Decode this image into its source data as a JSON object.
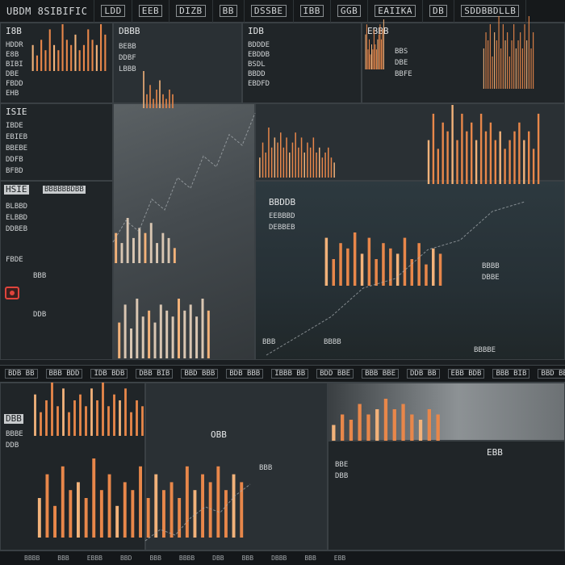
{
  "topbar": {
    "segments": [
      "UBDM 8SIBIFIC",
      "LDD",
      "EEB",
      "DIZB",
      "BB",
      "DSSBE",
      "IBB",
      "GGB",
      "EAIIKA",
      "DB",
      "SDDBBDLLB"
    ]
  },
  "panels": {
    "top_left": {
      "title": "I8B",
      "rows": [
        "HDDR",
        "E8B",
        "BIBI",
        "DBE",
        "FBDD",
        "EHB"
      ]
    },
    "top_mid": {
      "title": "DBBB",
      "rows": [
        "BEBB",
        "DDBF",
        "LBBB"
      ]
    },
    "top_center": {
      "title": "IDB",
      "rows": [
        "BDDDE",
        "EBDDB",
        "BSDL",
        "BBDD",
        "EBDFD"
      ]
    },
    "top_right": {
      "title": "EBBB",
      "rows": [
        "BBS",
        "DBE",
        "BBFE"
      ]
    },
    "mid_left": {
      "title": "ISIE",
      "rows": [
        "IBDE",
        "EBIEB",
        "BBEBE",
        "DDFB",
        "BFBD"
      ]
    },
    "side_left": {
      "title": "HSIE",
      "banner": "BBBBBBDBB",
      "rows": [
        "BLBBD",
        "ELBBD",
        "DDBEB",
        "FBDE",
        "BBB",
        "DDB"
      ]
    },
    "center_main": {
      "title": "BBDDB",
      "rows": [
        "EEBBBD",
        "DEBBEB",
        "BBBB",
        "DBBE"
      ],
      "footer": [
        "BBB",
        "BBBB",
        "BBBBE"
      ]
    },
    "center_right": {
      "rows": [
        "BBB",
        "DBB",
        "EBB"
      ]
    },
    "lower_left": {
      "title": "DBB",
      "rows": [
        "BBBE",
        "DDB"
      ]
    },
    "lower_mid": {
      "title": "OBB",
      "rows": [
        "BBB"
      ]
    },
    "lower_right": {
      "title": "EBB",
      "rows": [
        "BBE",
        "DBB"
      ]
    }
  },
  "ticker": [
    "BDB BB",
    "BBB BDD",
    "IDB BDB",
    "DBB BIB",
    "BBD BBB",
    "BDB BBB",
    "IBBB BB",
    "BDD BBE",
    "BBB BBE",
    "DDB BB",
    "EBB BDB",
    "BBB BIB",
    "BBD BB"
  ],
  "bottombar": [
    "BBBB",
    "BBB",
    "EBBB",
    "BBD",
    "BBB",
    "BBBB",
    "DBB",
    "BBB",
    "DBBB",
    "BBB",
    "EBB"
  ],
  "colors": {
    "bar_primary": "#e8874a",
    "bar_highlight": "#f2b27a",
    "bar_pale": "#d9c6b2",
    "alert": "#e0443c",
    "line": "#aeb4b8"
  },
  "chart_data": [
    {
      "type": "bar",
      "values": [
        5,
        3,
        6,
        4,
        8,
        5,
        4,
        9,
        6,
        5,
        7,
        4,
        5,
        8,
        6,
        5,
        9,
        7
      ]
    },
    {
      "type": "bar",
      "values": [
        8,
        3,
        5,
        2,
        4,
        6,
        3,
        2,
        4,
        3
      ]
    },
    {
      "type": "bar",
      "values": [
        7,
        9,
        4,
        6,
        3,
        5,
        4,
        8,
        5,
        4,
        6,
        7,
        9,
        6,
        8,
        10
      ]
    },
    {
      "type": "bar",
      "values": [
        5,
        7,
        6,
        8,
        4,
        7,
        6,
        9,
        5,
        8,
        6,
        7,
        4,
        6,
        8,
        5,
        6,
        7,
        5,
        8,
        6,
        9,
        5,
        7
      ]
    },
    {
      "type": "bar",
      "values": [
        4,
        7,
        5,
        10,
        6,
        8,
        7,
        9,
        6,
        8,
        5,
        7,
        9,
        6,
        8,
        5,
        7,
        6,
        8,
        5,
        6,
        4,
        5,
        6,
        4,
        3
      ]
    },
    {
      "type": "bar",
      "values": [
        6,
        4,
        9,
        5,
        7,
        6,
        8,
        4,
        6,
        5,
        3
      ]
    },
    {
      "type": "bar",
      "values": [
        5,
        8,
        4,
        7,
        6,
        9,
        5,
        8,
        6,
        7,
        5,
        8,
        6,
        7,
        5,
        6,
        4,
        5,
        6,
        7,
        5,
        6,
        4,
        8
      ]
    },
    {
      "type": "bar",
      "values": [
        6,
        9,
        5,
        10,
        7,
        8,
        6,
        9,
        8,
        7,
        10,
        8,
        9,
        7,
        10,
        8
      ]
    },
    {
      "type": "bar",
      "values": [
        9,
        5,
        8,
        7,
        10,
        6,
        9,
        5,
        8,
        7,
        6,
        9,
        5,
        8,
        4,
        7,
        6
      ]
    },
    {
      "type": "bar",
      "values": [
        7,
        4,
        6,
        9,
        5,
        8,
        4,
        6,
        7,
        5,
        8,
        6,
        9,
        5,
        7,
        6,
        8,
        4,
        6,
        5
      ]
    },
    {
      "type": "bar",
      "values": [
        3,
        5,
        4,
        7,
        5,
        6,
        8,
        6,
        7,
        5,
        4,
        6,
        5
      ]
    },
    {
      "type": "bar",
      "values": [
        5,
        8,
        4,
        9,
        6,
        7,
        5,
        10,
        6,
        8,
        4,
        7,
        6,
        9,
        5,
        8,
        6,
        7,
        5,
        9,
        6,
        8,
        7,
        9,
        6,
        8,
        7
      ]
    },
    {
      "type": "line",
      "values": [
        2,
        3,
        2.5,
        4,
        3.5,
        5,
        4.5,
        6,
        5.5,
        7,
        6.5,
        8
      ]
    },
    {
      "type": "line",
      "values": [
        1,
        2,
        3,
        4.5,
        5,
        6.5,
        7,
        8.5,
        9
      ]
    },
    {
      "type": "line",
      "values": [
        3,
        4,
        3.5,
        5,
        6,
        5.5,
        7,
        8
      ]
    }
  ]
}
